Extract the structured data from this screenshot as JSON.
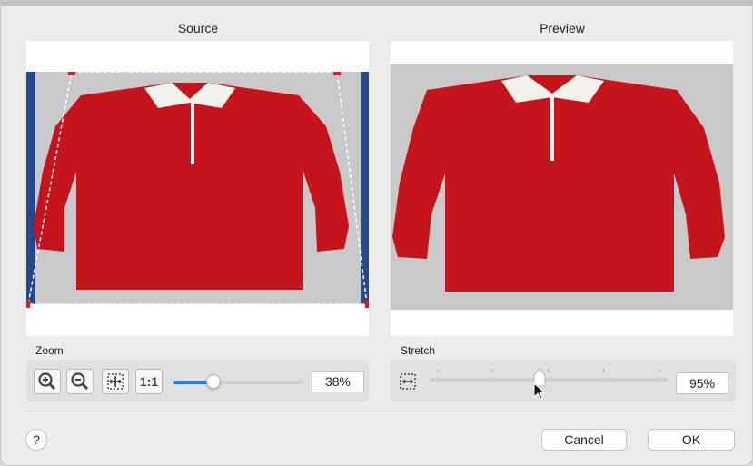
{
  "source": {
    "title": "Source"
  },
  "preview": {
    "title": "Preview"
  },
  "zoom": {
    "label": "Zoom",
    "zoom_in_icon": "zoom-in-icon",
    "zoom_out_icon": "zoom-out-icon",
    "fit_icon": "fit-to-window-icon",
    "actual_size_label": "1:1",
    "value": "38%",
    "slider_fraction": 0.31
  },
  "stretch": {
    "label": "Stretch",
    "icon": "stretch-icon",
    "value": "95%",
    "slider_fraction": 0.46
  },
  "footer": {
    "help_label": "?",
    "cancel_label": "Cancel",
    "ok_label": "OK"
  },
  "colors": {
    "accent": "#1f7cf5",
    "crop_handle": "#e0191f",
    "shirt": "#c5151c"
  }
}
